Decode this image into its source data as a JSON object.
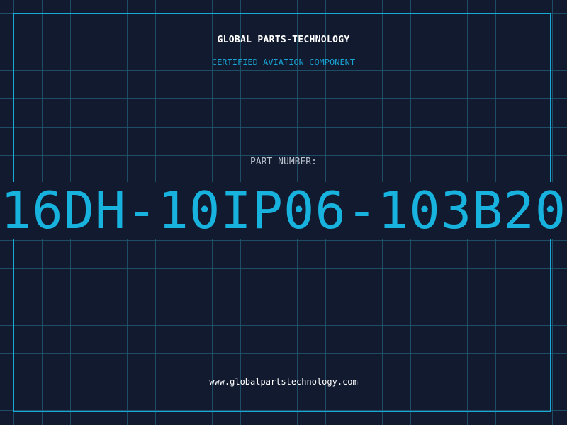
{
  "header": {
    "brand": "GLOBAL PARTS-TECHNOLOGY",
    "subtitle": "CERTIFIED AVIATION COMPONENT"
  },
  "part": {
    "label": "PART NUMBER:",
    "number": "16DH-10IP06-103B20"
  },
  "footer": {
    "website": "www.globalpartstechnology.com"
  },
  "colors": {
    "background": "#111a2f",
    "grid": "#225c76",
    "accent": "#18b2df",
    "text": "#ffffff",
    "muted": "#b8c0cc"
  }
}
